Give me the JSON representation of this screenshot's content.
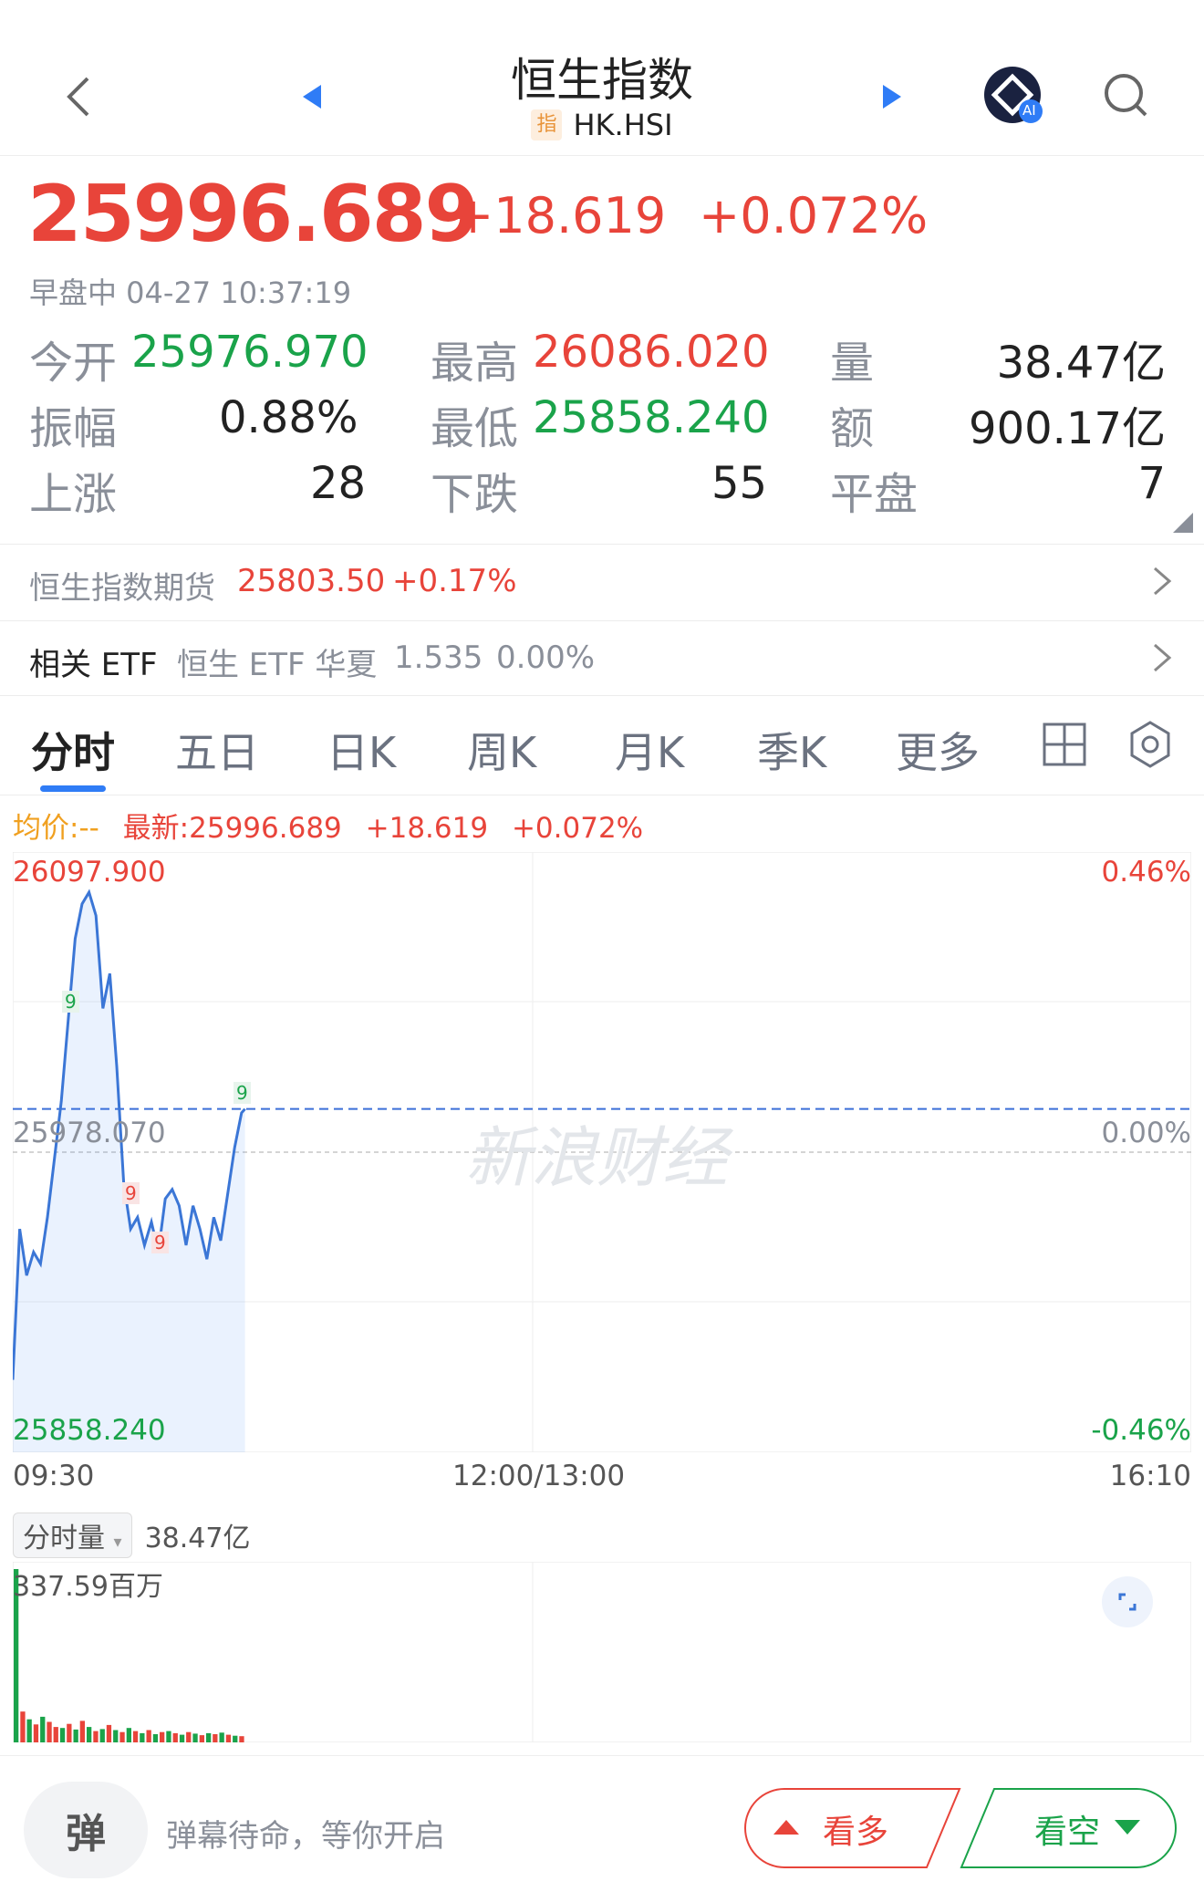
{
  "header": {
    "title": "恒生指数",
    "badge": "指",
    "symbol": "HK.HSI",
    "ai_badge": "AI",
    "icons": [
      "back-chevron-icon",
      "prev-triangle-icon",
      "next-triangle-icon",
      "ai-assistant-icon",
      "search-icon"
    ]
  },
  "quote": {
    "price": "25996.689",
    "change": "+18.619",
    "change_pct": "+0.072%",
    "status": "早盘中 04-27 10:37:19"
  },
  "stats": {
    "open_label": "今开",
    "open": "25976.970",
    "high_label": "最高",
    "high": "26086.020",
    "volume_label": "量",
    "volume": "38.47亿",
    "amplitude_label": "振幅",
    "amplitude": "0.88%",
    "low_label": "最低",
    "low": "25858.240",
    "amount_label": "额",
    "amount": "900.17亿",
    "up_label": "上涨",
    "up": "28",
    "down_label": "下跌",
    "down": "55",
    "flat_label": "平盘",
    "flat": "7"
  },
  "futures": {
    "label": "恒生指数期货",
    "price": "25803.50",
    "pct": "+0.17%"
  },
  "etf": {
    "label": "相关 ETF",
    "name": "恒生 ETF 华夏",
    "price": "1.535",
    "pct": "0.00%"
  },
  "tabs": [
    "分时",
    "五日",
    "日K",
    "周K",
    "月K",
    "季K",
    "更多"
  ],
  "tab_active": "分时",
  "info": {
    "avg": "均价:--",
    "latest": "最新:25996.689",
    "change": "+18.619",
    "pct": "+0.072%"
  },
  "chart_labels": {
    "y_top": "26097.900",
    "y_mid": "25978.070",
    "y_bottom": "25858.240",
    "pct_top": "0.46%",
    "pct_mid": "0.00%",
    "pct_bottom": "-0.46%",
    "x_start": "09:30",
    "x_mid": "12:00/13:00",
    "x_end": "16:10",
    "watermark": "新浪财经",
    "markers": [
      "9",
      "9",
      "9",
      "9"
    ]
  },
  "chart_data": {
    "type": "line",
    "title": "",
    "xlabel": "",
    "ylabel": "",
    "ylim": [
      25858.24,
      26097.9
    ],
    "reference": 25978.07,
    "latest": 25996.689,
    "x": [
      "09:30",
      "09:32",
      "09:34",
      "09:36",
      "09:38",
      "09:40",
      "09:42",
      "09:44",
      "09:46",
      "09:48",
      "09:50",
      "09:52",
      "09:54",
      "09:56",
      "09:58",
      "10:00",
      "10:02",
      "10:04",
      "10:06",
      "10:08",
      "10:10",
      "10:12",
      "10:14",
      "10:16",
      "10:18",
      "10:20",
      "10:22",
      "10:24",
      "10:26",
      "10:28",
      "10:30",
      "10:32",
      "10:34",
      "10:36",
      "10:37"
    ],
    "values": [
      25880,
      25945,
      25925,
      25935,
      25930,
      25950,
      25975,
      26000,
      26035,
      26070,
      26085,
      26090,
      26080,
      26040,
      26055,
      26015,
      25965,
      25945,
      25950,
      25938,
      25948,
      25935,
      25958,
      25962,
      25955,
      25938,
      25955,
      25945,
      25932,
      25950,
      25940,
      25960,
      25980,
      25995,
      25996.689
    ],
    "volume": {
      "unit": "百万",
      "max_label": "337.59百万",
      "total": "38.47亿",
      "values": [
        337.59,
        60,
        45,
        35,
        50,
        40,
        30,
        28,
        36,
        25,
        42,
        30,
        22,
        26,
        34,
        24,
        20,
        28,
        22,
        18,
        24,
        16,
        20,
        22,
        18,
        15,
        20,
        17,
        14,
        18,
        16,
        19,
        15,
        13,
        12
      ],
      "colors": [
        "#1aa34a",
        "#e8443a",
        "#1aa34a",
        "#e8443a",
        "#1aa34a",
        "#e8443a",
        "#e8443a",
        "#1aa34a",
        "#e8443a",
        "#1aa34a",
        "#e8443a",
        "#1aa34a",
        "#e8443a",
        "#1aa34a",
        "#e8443a",
        "#1aa34a",
        "#e8443a",
        "#1aa34a",
        "#e8443a",
        "#1aa34a",
        "#e8443a",
        "#1aa34a",
        "#e8443a",
        "#1aa34a",
        "#e8443a",
        "#1aa34a",
        "#e8443a",
        "#1aa34a",
        "#e8443a",
        "#1aa34a",
        "#e8443a",
        "#1aa34a",
        "#e8443a",
        "#1aa34a",
        "#e8443a"
      ]
    }
  },
  "volume_panel": {
    "selector": "分时量",
    "total": "38.47亿",
    "max": "337.59百万"
  },
  "bottom": {
    "danmu_icon_text": "弹",
    "danmu_placeholder": "弹幕待命，等你开启",
    "bull": "看多",
    "bear": "看空"
  },
  "colors": {
    "up": "#e8443a",
    "down": "#1aa34a",
    "accent": "#2f7cf6",
    "avg": "#f0a020"
  }
}
